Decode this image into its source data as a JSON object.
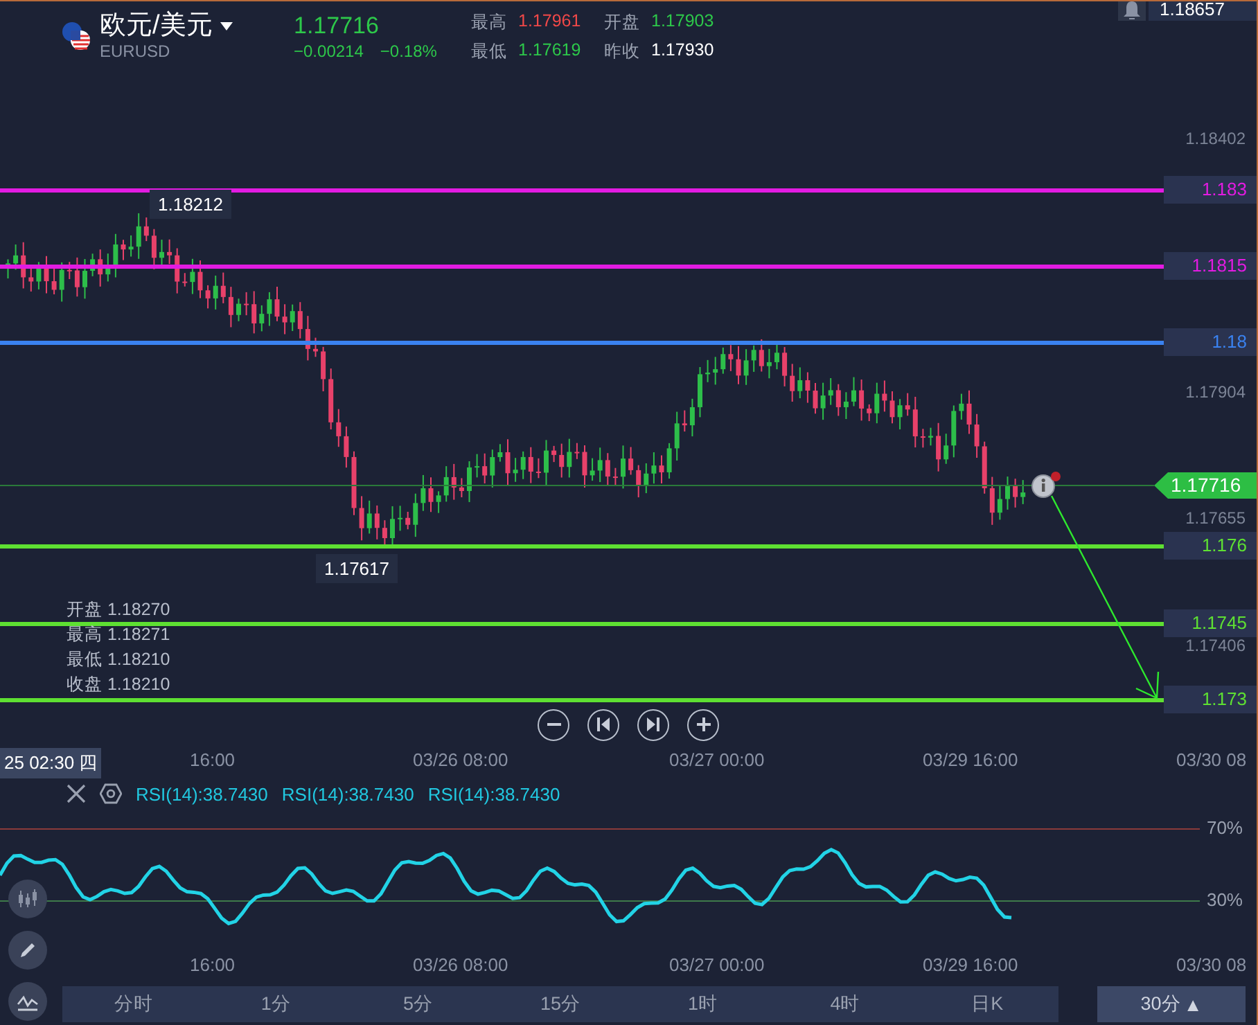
{
  "quote": {
    "name": "欧元/美元",
    "symbol": "EURUSD",
    "price": "1.17716",
    "change": "−0.00214",
    "change_pct": "−0.18%",
    "stats": [
      {
        "label": "最高",
        "value": "1.17961",
        "color": "#f04848"
      },
      {
        "label": "开盘",
        "value": "1.17903",
        "color": "#2dc84a"
      },
      {
        "label": "最低",
        "value": "1.17619",
        "color": "#2dc84a"
      },
      {
        "label": "昨收",
        "value": "1.17930",
        "color": "#ffffff"
      }
    ]
  },
  "top_price": "1.18657",
  "chart": {
    "price_axis": [
      "1.18402",
      "1.17904",
      "1.17655",
      "1.17406"
    ],
    "price_lines": [
      {
        "label": "1.183",
        "color": "#e21be2"
      },
      {
        "label": "1.1815",
        "color": "#e21be2"
      },
      {
        "label": "1.18",
        "color": "#3a82f0"
      },
      {
        "label": "1.176",
        "color": "#5ee032"
      },
      {
        "label": "1.1745",
        "color": "#5ee032"
      },
      {
        "label": "1.173",
        "color": "#5ee032"
      }
    ],
    "current_price": "1.17716",
    "high_label": "1.18212",
    "low_label": "1.17617",
    "ohlc": [
      {
        "label": "开盘",
        "value": "1.18270"
      },
      {
        "label": "最高",
        "value": "1.18271"
      },
      {
        "label": "最低",
        "value": "1.18210"
      },
      {
        "label": "收盘",
        "value": "1.18210"
      }
    ]
  },
  "time_axis": {
    "cursor_time": "25 02:30 四",
    "labels": [
      "16:00",
      "03/26 08:00",
      "03/27 00:00",
      "03/29 16:00",
      "03/30 08"
    ]
  },
  "rsi": {
    "legend": [
      "RSI(14):38.7430",
      "RSI(14):38.7430",
      "RSI(14):38.7430"
    ],
    "levels": [
      "70%",
      "30%"
    ],
    "time_labels": [
      "16:00",
      "03/26 08:00",
      "03/27 00:00",
      "03/29 16:00",
      "03/30 08"
    ]
  },
  "periods": [
    {
      "label": "分时",
      "selected": false
    },
    {
      "label": "1分",
      "selected": false
    },
    {
      "label": "5分",
      "selected": false
    },
    {
      "label": "15分",
      "selected": false
    },
    {
      "label": "1时",
      "selected": false
    },
    {
      "label": "4时",
      "selected": false
    },
    {
      "label": "日K",
      "selected": false
    },
    {
      "label": "30分",
      "selected": true,
      "caret": "▲"
    }
  ]
}
